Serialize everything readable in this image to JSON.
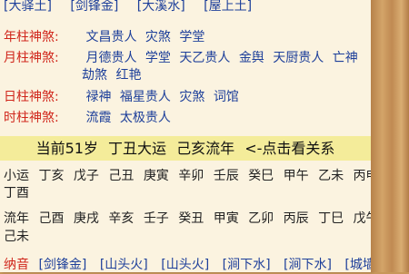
{
  "nayin_top": [
    "[大驿土]",
    "[剑锋金]",
    "[大溪水]",
    "[屋上土]"
  ],
  "year": {
    "label": "年柱神煞:",
    "items": [
      "文昌贵人",
      "灾煞",
      "学堂"
    ]
  },
  "month": {
    "label": "月柱神煞:",
    "items": [
      "月德贵人",
      "学堂",
      "天乙贵人",
      "金舆",
      "天厨贵人",
      "亡神"
    ],
    "items2": [
      "劫煞",
      "红艳"
    ]
  },
  "day": {
    "label": "日柱神煞:",
    "items": [
      "禄神",
      "福星贵人",
      "灾煞",
      "词馆"
    ]
  },
  "hour": {
    "label": "时柱神煞:",
    "items": [
      "流霞",
      "太极贵人"
    ]
  },
  "current": {
    "age": "当前51岁",
    "dayun": "丁丑大运",
    "liunian": "己亥流年",
    "link": "<-点击看关系"
  },
  "xiaoyun": {
    "label": "小运",
    "items": [
      "丁亥",
      "戊子",
      "己丑",
      "庚寅",
      "辛卯",
      "壬辰",
      "癸巳",
      "甲午",
      "乙未",
      "丙申"
    ],
    "items2": [
      "丁酉"
    ]
  },
  "liunian": {
    "label": "流年",
    "items": [
      "己酉",
      "庚戌",
      "辛亥",
      "壬子",
      "癸丑",
      "甲寅",
      "乙卯",
      "丙辰",
      "丁巳",
      "戊午"
    ],
    "items2": [
      "己未"
    ]
  },
  "nayin_bottom": {
    "label": "纳音",
    "items": [
      "[剑锋金]",
      "[山头火]",
      "[山头火]",
      "[涧下水]",
      "[涧下水]",
      "[城墙土]"
    ]
  }
}
